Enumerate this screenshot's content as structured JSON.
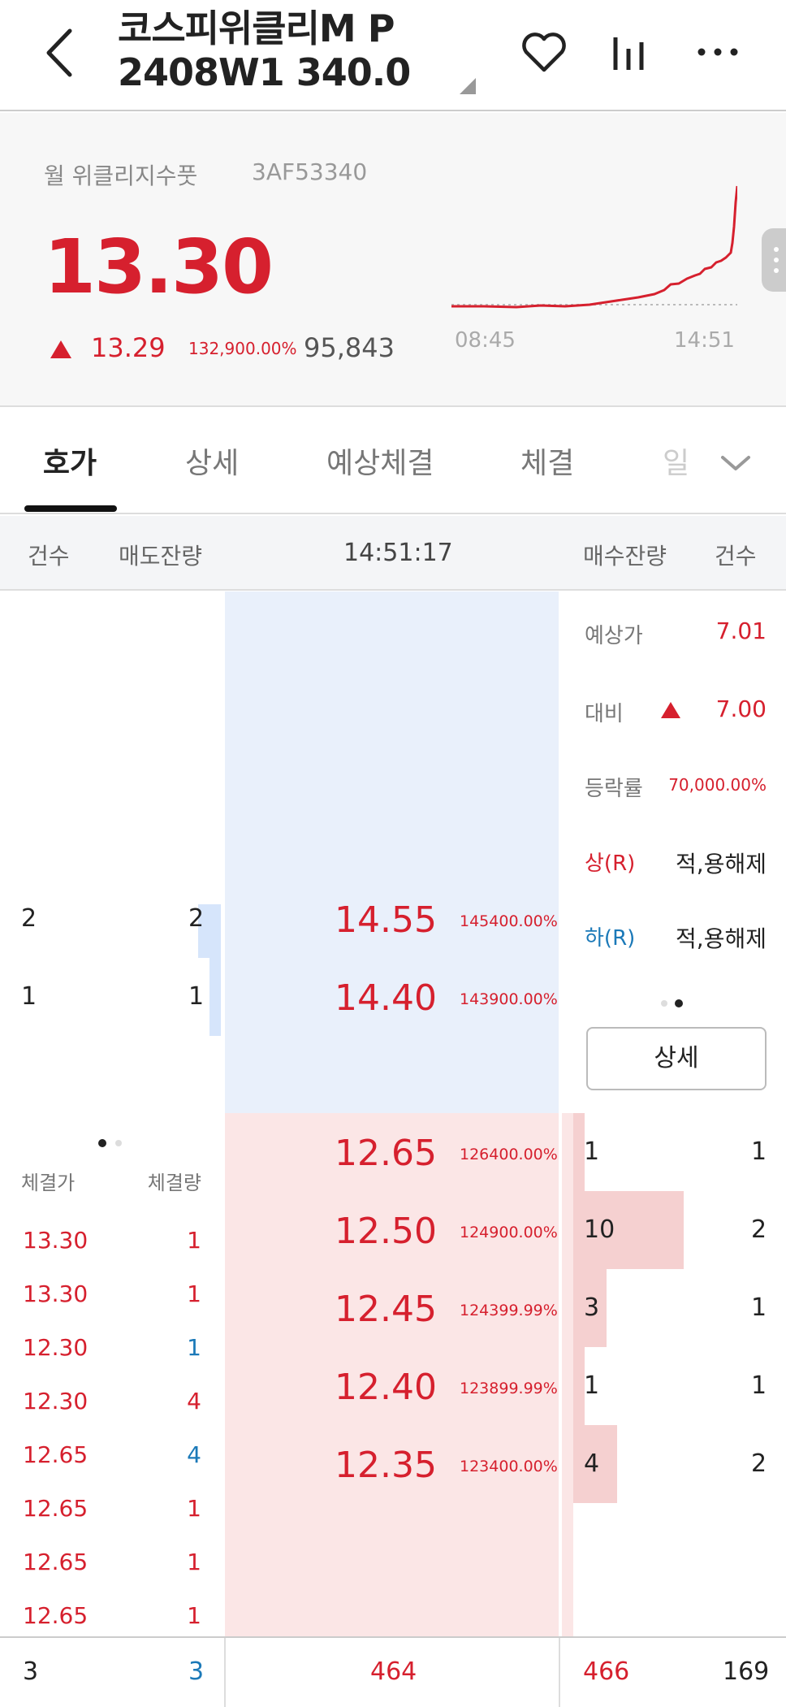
{
  "header": {
    "title_line1": "코스피위클리M P",
    "title_line2": "2408W1 340.0"
  },
  "info": {
    "category": "월 위클리지수풋",
    "code": "3AF53340",
    "price": "13.30",
    "change": "13.29",
    "change_rate": "132,900.00%",
    "volume": "95,843",
    "chart_start_time": "08:45",
    "chart_end_time": "14:51"
  },
  "tabs": [
    "호가",
    "상세",
    "예상체결",
    "체결",
    "일"
  ],
  "orderbook_header": {
    "ask_count": "건수",
    "ask_qty": "매도잔량",
    "time": "14:51:17",
    "bid_qty": "매수잔량",
    "bid_count": "건수"
  },
  "expected": {
    "price_label": "예상가",
    "price": "7.01",
    "diff_label": "대비",
    "diff": "7.00",
    "rate_label": "등락률",
    "rate": "70,000.00%",
    "upper_label": "상(R)",
    "upper_value": "적,용해제",
    "lower_label": "하(R)",
    "lower_value": "적,용해제",
    "detail_button": "상세"
  },
  "asks": [
    {
      "count": "2",
      "qty": "2",
      "price": "14.55",
      "rate": "145400.00%",
      "level": 1.0
    },
    {
      "count": "1",
      "qty": "1",
      "price": "14.40",
      "rate": "143900.00%",
      "level": 0.5
    }
  ],
  "bids": [
    {
      "price": "12.65",
      "rate": "126400.00%",
      "qty": "1",
      "count": "1",
      "level": 0.1
    },
    {
      "price": "12.50",
      "rate": "124900.00%",
      "qty": "10",
      "count": "2",
      "level": 1.0
    },
    {
      "price": "12.45",
      "rate": "124399.99%",
      "qty": "3",
      "count": "1",
      "level": 0.3
    },
    {
      "price": "12.40",
      "rate": "123899.99%",
      "qty": "1",
      "count": "1",
      "level": 0.1
    },
    {
      "price": "12.35",
      "rate": "123400.00%",
      "qty": "4",
      "count": "2",
      "level": 0.4
    }
  ],
  "trades_header": {
    "price": "체결가",
    "qty": "체결량"
  },
  "trades": [
    {
      "price": "13.30",
      "qty": "1",
      "qty_color": "#d6202e"
    },
    {
      "price": "13.30",
      "qty": "1",
      "qty_color": "#d6202e"
    },
    {
      "price": "12.30",
      "qty": "1",
      "qty_color": "#1b79b8"
    },
    {
      "price": "12.30",
      "qty": "4",
      "qty_color": "#d6202e"
    },
    {
      "price": "12.65",
      "qty": "4",
      "qty_color": "#1b79b8"
    },
    {
      "price": "12.65",
      "qty": "1",
      "qty_color": "#d6202e"
    },
    {
      "price": "12.65",
      "qty": "1",
      "qty_color": "#d6202e"
    },
    {
      "price": "12.65",
      "qty": "1",
      "qty_color": "#d6202e"
    }
  ],
  "footer": {
    "ask_count": "3",
    "ask_qty": "3",
    "ask_total": "464",
    "bid_total": "466",
    "bid_count": "169"
  },
  "colors": {
    "up": "#d6202e",
    "down": "#1b79b8",
    "ask_bg": "#e9f0fb",
    "bid_bg": "#fbe6e6"
  }
}
